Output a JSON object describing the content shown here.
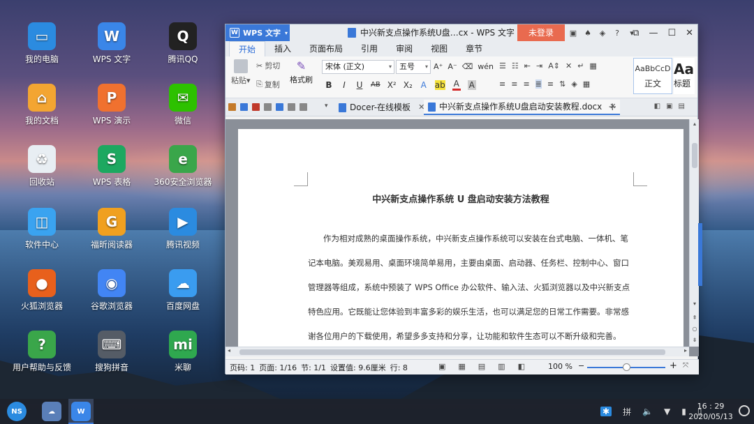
{
  "desktop": {
    "icons": [
      {
        "label": "我的电脑",
        "color": "#2b8be0",
        "glyph": "▭"
      },
      {
        "label": "我的文档",
        "color": "#f3a532",
        "glyph": "⌂"
      },
      {
        "label": "回收站",
        "color": "#e8eef3",
        "glyph": "♻"
      },
      {
        "label": "软件中心",
        "color": "#3aa3f0",
        "glyph": "◫"
      },
      {
        "label": "火狐浏览器",
        "color": "#e8601c",
        "glyph": "●"
      },
      {
        "label": "用户帮助与反馈",
        "color": "#3aa64a",
        "glyph": "?"
      },
      {
        "label": "WPS 文字",
        "color": "#3a86e8",
        "glyph": "W"
      },
      {
        "label": "WPS 演示",
        "color": "#f0712f",
        "glyph": "P"
      },
      {
        "label": "WPS 表格",
        "color": "#1da860",
        "glyph": "S"
      },
      {
        "label": "福昕阅读器",
        "color": "#f0a020",
        "glyph": "G"
      },
      {
        "label": "谷歌浏览器",
        "color": "#4285f4",
        "glyph": "◉"
      },
      {
        "label": "搜狗拼音",
        "color": "#555c66",
        "glyph": "⌨"
      },
      {
        "label": "腾讯QQ",
        "color": "#222222",
        "glyph": "Q"
      },
      {
        "label": "微信",
        "color": "#2dc100",
        "glyph": "✉"
      },
      {
        "label": "360安全浏览器",
        "color": "#3aa64a",
        "glyph": "e"
      },
      {
        "label": "腾讯视频",
        "color": "#2b8be0",
        "glyph": "▶"
      },
      {
        "label": "百度网盘",
        "color": "#3a9cf0",
        "glyph": "☁"
      },
      {
        "label": "米聊",
        "color": "#2fa84f",
        "glyph": "mi"
      }
    ]
  },
  "window": {
    "app_badge": "WPS 文字",
    "title": "中兴新支点操作系统U盘…cx - WPS 文字",
    "login": "未登录",
    "title_icons": [
      "▣",
      "♠",
      "◈",
      "?",
      "▾"
    ],
    "controls": {
      "restore": "⧉",
      "minimize": "—",
      "maximize": "☐",
      "close": "✕"
    },
    "menu_tabs": [
      "开始",
      "插入",
      "页面布局",
      "引用",
      "审阅",
      "视图",
      "章节"
    ],
    "active_tab": "开始",
    "ribbon": {
      "paste": "粘贴",
      "paste_arrow": "▾",
      "cut": "剪切",
      "copy": "复制",
      "format_painter": "格式刷",
      "font_name": "宋体 (正文)",
      "font_size": "五号",
      "grow_font": "A⁺",
      "shrink_font": "A⁻",
      "clear_format": "⌫",
      "phonetic": "wén",
      "format_buttons": [
        "B",
        "I",
        "U",
        "AB",
        "X²",
        "X₂",
        "A",
        "ab",
        "A",
        "A"
      ],
      "para_row1": [
        "☰",
        "☷",
        "⇤",
        "⇥",
        "A⇕",
        "✕",
        "↵",
        "▦"
      ],
      "para_row2": [
        "≡",
        "≡",
        "≡",
        "≣",
        "≡",
        "⇅",
        "◈",
        "▦"
      ],
      "style_normal_sample": "AaBbCcD",
      "style_normal_name": "正文",
      "style_heading_sample": "Aa",
      "style_heading_name": "标题"
    },
    "doc_tabs": [
      {
        "label": "Docer-在线模板",
        "close": "✕"
      },
      {
        "label": "中兴新支点操作系统U盘启动安装教程.docx",
        "close": "✕"
      }
    ],
    "new_tab": "+",
    "document": {
      "heading": "中兴新支点操作系统 U 盘启动安装方法教程",
      "lines": [
        "作为相对成熟的桌面操作系统，中兴新支点操作系统可以安装在台式电脑、一体机、笔",
        "记本电脑。美观易用、桌面环境简单易用，主要由桌面、启动器、任务栏、控制中心、窗口",
        "管理器等组成，系统中预装了 WPS Office 办公软件、输入法、火狐浏览器以及中兴新支点",
        "特色应用。它既能让您体验到丰富多彩的娱乐生活，也可以满足您的日常工作需要。非常感",
        "谢各位用户的下载使用，希望多多支持和分享，让功能和软件生态可以不断升级和完善。"
      ]
    },
    "status": {
      "page_code": "页码: 1",
      "pages": "页面: 1/16",
      "section": "节: 1/1",
      "setting": "设置值: 9.6厘米",
      "row": "行: 8",
      "zoom": "100 %",
      "zoom_minus": "−",
      "zoom_plus": "+",
      "zoom_fraction": 0.5
    }
  },
  "taskbar": {
    "start": "NS",
    "items": [
      {
        "label": "NS",
        "color": "#2b8be0"
      },
      {
        "label": "☁",
        "color": "#5a7fb8"
      },
      {
        "label": "W",
        "color": "#3a86e8"
      }
    ],
    "tray": [
      "✱",
      "拼",
      "🔈",
      "▼",
      "▮",
      "▯"
    ],
    "time": "16 : 29",
    "date": "2020/05/13"
  }
}
